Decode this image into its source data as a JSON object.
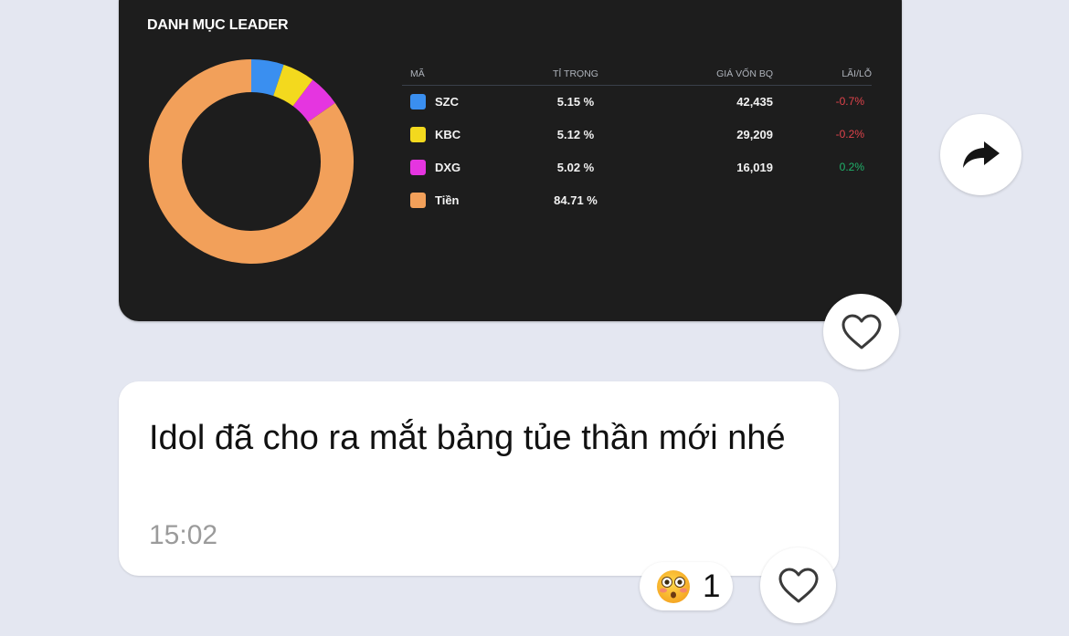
{
  "portfolio_card": {
    "title": "DANH MỤC LEADER",
    "headers": {
      "code": "MÃ",
      "weight": "TỈ TRỌNG",
      "avg_cost": "GIÁ VỐN BQ",
      "pnl": "LÃI/LỖ"
    },
    "rows": [
      {
        "code": "SZC",
        "weight": "5.15  %",
        "avg_cost": "42,435",
        "pnl": "-0.7%",
        "color": "#3a8ff0",
        "pnl_color": "#e0434b"
      },
      {
        "code": "KBC",
        "weight": "5.12  %",
        "avg_cost": "29,209",
        "pnl": "-0.2%",
        "color": "#f3d91e",
        "pnl_color": "#e0434b"
      },
      {
        "code": "DXG",
        "weight": "5.02  %",
        "avg_cost": "16,019",
        "pnl": "0.2%",
        "color": "#e535e0",
        "pnl_color": "#20b26b"
      },
      {
        "code": "Tiền",
        "weight": "84.71  %",
        "avg_cost": "",
        "pnl": "",
        "color": "#f2a05a",
        "pnl_color": "#ffffff"
      }
    ]
  },
  "chart_data": {
    "type": "pie",
    "title": "DANH MỤC LEADER",
    "categories": [
      "SZC",
      "KBC",
      "DXG",
      "Tiền"
    ],
    "values": [
      5.15,
      5.12,
      5.02,
      84.71
    ],
    "colors": [
      "#3a8ff0",
      "#f3d91e",
      "#e535e0",
      "#f2a05a"
    ],
    "donut": true
  },
  "message": {
    "text": "Idol đã cho ra mắt bảng tủe thần mới nhé",
    "time": "15:02"
  },
  "reaction": {
    "emoji": "flushed-face-emoji",
    "count": "1"
  },
  "icons": {
    "share": "share-arrow-icon",
    "like": "heart-outline-icon"
  },
  "colors": {
    "background": "#e4e7f1",
    "card": "#1d1d1d"
  }
}
